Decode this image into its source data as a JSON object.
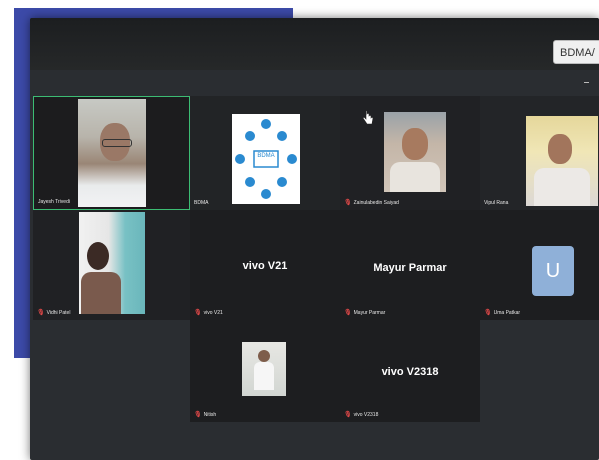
{
  "app": {
    "host_tab_label": "BDMA/",
    "colors": {
      "background": "#2a2d31",
      "tile_background": "#1c1c1e",
      "active_speaker_border": "#3cbc73",
      "muted_icon": "#e04848",
      "slide_frame": "#3c4aa8"
    }
  },
  "participants": [
    {
      "id": "jayesh",
      "label": "Jayesh Trivedi",
      "muted": false,
      "active": true,
      "type": "video"
    },
    {
      "id": "bdma",
      "label": "BDMA",
      "muted": false,
      "active": false,
      "type": "logo",
      "logo_text": "BDMA"
    },
    {
      "id": "zainulabedin",
      "label": "Zainulabedin Saiyad",
      "muted": true,
      "active": false,
      "type": "video"
    },
    {
      "id": "vipul",
      "label": "Vipul Rana",
      "muted": false,
      "active": false,
      "type": "video"
    },
    {
      "id": "vidhi",
      "label": "Vidhi Patel",
      "muted": true,
      "active": false,
      "type": "video"
    },
    {
      "id": "vivo-v21",
      "label": "vivo V21",
      "muted": true,
      "active": false,
      "type": "name",
      "display_name": "vivo V21"
    },
    {
      "id": "mayur",
      "label": "Mayur Parmar",
      "muted": true,
      "active": false,
      "type": "name",
      "display_name": "Mayur Parmar"
    },
    {
      "id": "uma",
      "label": "Uma Patkar",
      "muted": true,
      "active": false,
      "type": "avatar",
      "initial": "U"
    },
    {
      "id": "nitish",
      "label": "Nitish",
      "muted": true,
      "active": false,
      "type": "video"
    },
    {
      "id": "vivo-v2318",
      "label": "vivo V2318",
      "muted": true,
      "active": false,
      "type": "name",
      "display_name": "vivo V2318"
    }
  ],
  "icons": {
    "muted": "mic-off-icon",
    "pointer": "hand-cursor-icon"
  }
}
